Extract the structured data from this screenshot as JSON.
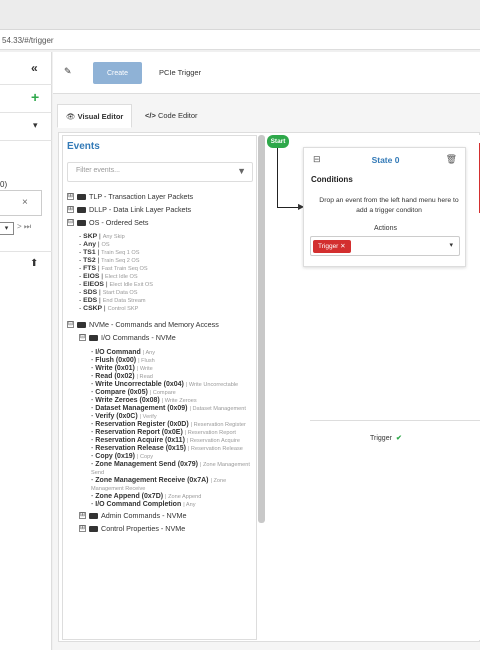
{
  "url": "54.33/#/trigger",
  "left_panel": {
    "collapse_symbol": "«",
    "add_symbol": "+",
    "dropdown_symbol": "▾",
    "value_fragment": "0)",
    "close_symbol": "×",
    "next_symbols": "> ⏭",
    "upload_symbol": "⬆"
  },
  "toolbar": {
    "create_label": "Create",
    "trigger_name": "PCIe Trigger"
  },
  "tabs": [
    {
      "label": "Visual Editor"
    },
    {
      "label": "Code Editor"
    }
  ],
  "events_panel": {
    "title": "Events",
    "filter_placeholder": "Filter events...",
    "groups": [
      {
        "toggle": "⊞",
        "label": "TLP - Transaction Layer Packets"
      },
      {
        "toggle": "⊞",
        "label": "DLLP - Data Link Layer Packets"
      },
      {
        "toggle": "⊟",
        "label": "OS - Ordered Sets"
      }
    ],
    "os_events": [
      {
        "name": "SKP",
        "desc": "Any Skip"
      },
      {
        "name": "Any",
        "desc": "OS"
      },
      {
        "name": "TS1",
        "desc": "Train Seq 1 OS"
      },
      {
        "name": "TS2",
        "desc": "Train Seq 2 OS"
      },
      {
        "name": "FTS",
        "desc": "Fast Train Seq OS"
      },
      {
        "name": "EIOS",
        "desc": "Elect Idle OS"
      },
      {
        "name": "EIEOS",
        "desc": "Elect Idle Exit OS"
      },
      {
        "name": "SDS",
        "desc": "Start Data OS"
      },
      {
        "name": "EDS",
        "desc": "End Data Stream"
      },
      {
        "name": "CSKP",
        "desc": "Control SKP"
      }
    ],
    "nvme_group": {
      "toggle": "⊟",
      "label": "NVMe - Commands and Memory Access"
    },
    "io_group": {
      "toggle": "⊟",
      "label": "I/O Commands - NVMe"
    },
    "io_events": [
      {
        "name": "I/O Command",
        "desc": "Any"
      },
      {
        "name": "Flush (0x00)",
        "desc": "Flush"
      },
      {
        "name": "Write (0x01)",
        "desc": "Write"
      },
      {
        "name": "Read (0x02)",
        "desc": "Read"
      },
      {
        "name": "Write Uncorrectable (0x04)",
        "desc": "Write Uncorrectable"
      },
      {
        "name": "Compare (0x05)",
        "desc": "Compare"
      },
      {
        "name": "Write Zeroes (0x08)",
        "desc": "Write Zeroes"
      },
      {
        "name": "Dataset Management (0x09)",
        "desc": "Dataset Management"
      },
      {
        "name": "Verify (0x0C)",
        "desc": "Verify"
      },
      {
        "name": "Reservation Register (0x0D)",
        "desc": "Reservation Register"
      },
      {
        "name": "Reservation Report (0x0E)",
        "desc": "Reservation Report"
      },
      {
        "name": "Reservation Acquire (0x11)",
        "desc": "Reservation Acquire"
      },
      {
        "name": "Reservation Release (0x15)",
        "desc": "Reservation Release"
      },
      {
        "name": "Copy (0x19)",
        "desc": "Copy"
      },
      {
        "name": "Zone Management Send (0x79)",
        "desc": "Zone Management Send"
      },
      {
        "name": "Zone Management Receive (0x7A)",
        "desc": "Zone Management Receive"
      },
      {
        "name": "Zone Append (0x7D)",
        "desc": "Zone Append"
      },
      {
        "name": "I/O Command Completion",
        "desc": "Any"
      }
    ],
    "admin_group": {
      "toggle": "⊞",
      "label": "Admin Commands - NVMe"
    },
    "control_group": {
      "toggle": "⊞",
      "label": "Control Properties - NVMe"
    }
  },
  "canvas": {
    "start_label": "Start",
    "state_title": "State 0",
    "conditions_label": "Conditions",
    "drop_text": "Drop an event from the left hand menu here to add a trigger conditon",
    "actions_label": "Actions",
    "action_badge": "Trigger",
    "trigger_label": "Trigger",
    "check_symbol": "✔"
  }
}
